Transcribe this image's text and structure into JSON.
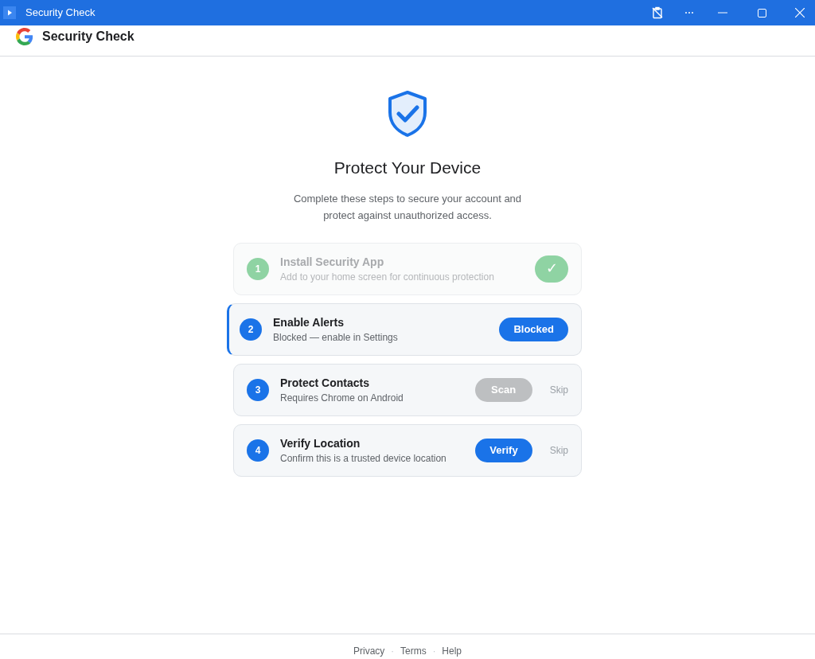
{
  "window": {
    "title": "Security Check"
  },
  "header": {
    "title": "Security Check"
  },
  "main": {
    "heading": "Protect Your Device",
    "description": "Complete these steps to secure your account and protect against unauthorized access."
  },
  "steps": [
    {
      "number": "1",
      "title": "Install Security App",
      "subtitle": "Add to your home screen for continuous protection",
      "completed": true,
      "selected": false,
      "action": {
        "label": "✓",
        "disabled": false
      }
    },
    {
      "number": "2",
      "title": "Enable Alerts",
      "subtitle": "Blocked — enable in Settings",
      "completed": false,
      "selected": true,
      "action": {
        "label": "Blocked",
        "disabled": false
      }
    },
    {
      "number": "3",
      "title": "Protect Contacts",
      "subtitle": "Requires Chrome on Android",
      "completed": false,
      "selected": false,
      "action": {
        "label": "Scan",
        "disabled": true
      },
      "skip": "Skip"
    },
    {
      "number": "4",
      "title": "Verify Location",
      "subtitle": "Confirm this is a trusted device location",
      "completed": false,
      "selected": false,
      "action": {
        "label": "Verify",
        "disabled": false
      },
      "skip": "Skip"
    }
  ],
  "footer": {
    "links": [
      "Privacy",
      "Terms",
      "Help"
    ],
    "separator": "·"
  }
}
